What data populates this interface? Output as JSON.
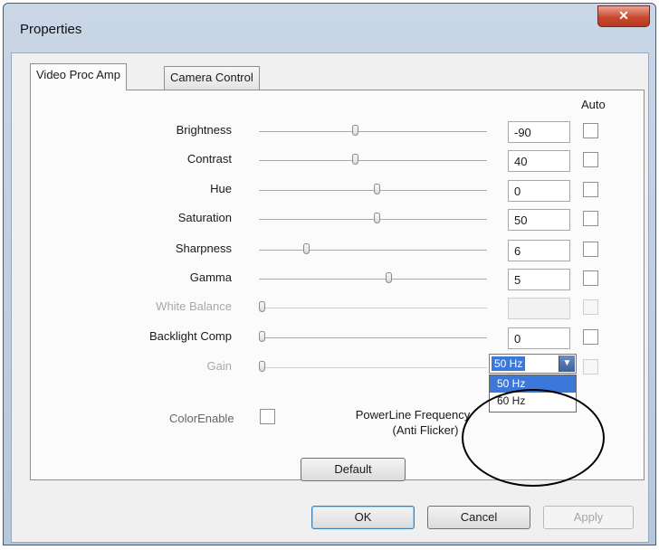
{
  "window": {
    "title": "Properties",
    "close_glyph": "✕"
  },
  "tabs": [
    {
      "label": "Video Proc Amp",
      "active": true
    },
    {
      "label": "Camera Control",
      "active": false
    }
  ],
  "auto_header": "Auto",
  "controls": [
    {
      "label": "Brightness",
      "value": "-90",
      "slider_level": 0.42,
      "enabled": true,
      "auto": false
    },
    {
      "label": "Contrast",
      "value": "40",
      "slider_level": 0.42,
      "enabled": true,
      "auto": false
    },
    {
      "label": "Hue",
      "value": "0",
      "slider_level": 0.52,
      "enabled": true,
      "auto": false
    },
    {
      "label": "Saturation",
      "value": "50",
      "slider_level": 0.52,
      "enabled": true,
      "auto": false
    },
    {
      "label": "Sharpness",
      "value": "6",
      "slider_level": 0.2,
      "enabled": true,
      "auto": false
    },
    {
      "label": "Gamma",
      "value": "5",
      "slider_level": 0.57,
      "enabled": true,
      "auto": false
    },
    {
      "label": "White Balance",
      "value": "",
      "slider_level": 0.0,
      "enabled": false,
      "auto": false
    },
    {
      "label": "Backlight Comp",
      "value": "0",
      "slider_level": 0.0,
      "enabled": true,
      "auto": false
    },
    {
      "label": "Gain",
      "value": "",
      "slider_level": 0.0,
      "enabled": false,
      "auto": false
    }
  ],
  "color_enable": {
    "label": "ColorEnable"
  },
  "powerline": {
    "label_line1": "PowerLine Frequency",
    "label_line2": "(Anti Flicker)",
    "selected": "50 Hz",
    "options": [
      "50 Hz",
      "60 Hz"
    ],
    "arrow_glyph": "▼"
  },
  "buttons": {
    "default": "Default",
    "ok": "OK",
    "cancel": "Cancel",
    "apply": "Apply"
  },
  "colors": {
    "accent": "#3b78d9",
    "close": "#c9492f"
  }
}
